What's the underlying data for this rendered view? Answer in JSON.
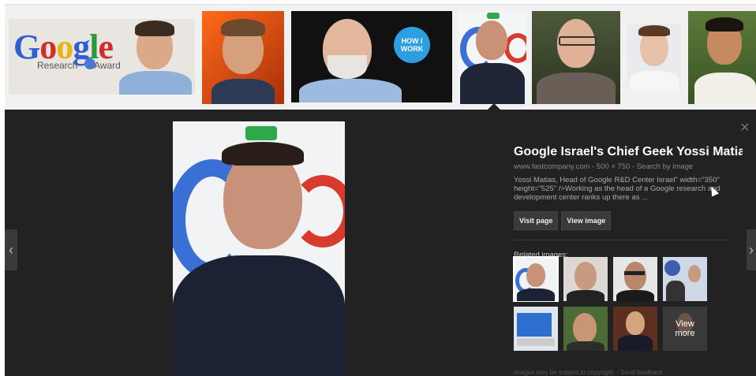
{
  "strip": {
    "google_logo_text": "Google",
    "research_text": "Research",
    "award_text": "Award",
    "how_i_work": "HOW I WORK"
  },
  "preview": {
    "title": "Google Israel's Chief Geek Yossi Matia…",
    "source": "www.fastcompany.com - 500 × 750 - Search by image",
    "description": "Yossi Matias, Head of Google R&D Center Israel\" width=\"350\" height=\"525\" />Working as the head of a Google research and development center ranks up there as ...",
    "visit_page": "Visit page",
    "view_image": "View image",
    "related_label": "Related images:",
    "view_more": "View more",
    "footer": "Images may be subject to copyright. - Send feedback"
  },
  "nav": {
    "prev_glyph": "‹",
    "next_glyph": "›",
    "close_glyph": "×"
  }
}
